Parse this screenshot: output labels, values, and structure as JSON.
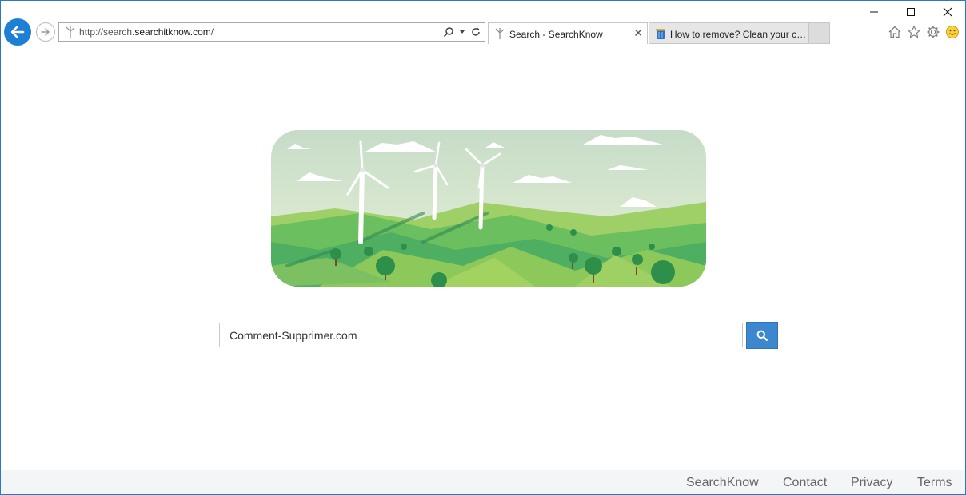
{
  "browser": {
    "address": {
      "url_prefix": "http://search.",
      "url_domain": "searchitknow.com",
      "url_suffix": "/"
    },
    "tabs": [
      {
        "label": "Search - SearchKnow",
        "active": true,
        "icon": "windmill-icon"
      },
      {
        "label": "How to remove? Clean your co...",
        "active": false,
        "icon": "trash-bin-icon"
      }
    ],
    "close_tab_symbol": "✕"
  },
  "search": {
    "value": "Comment-Supprimer.com",
    "placeholder": ""
  },
  "footer": {
    "links": [
      "SearchKnow",
      "Contact",
      "Privacy",
      "Terms"
    ]
  },
  "colors": {
    "accent": "#1e7fd6",
    "search_button": "#3d87cf",
    "footer_bg": "#f4f5f6"
  }
}
